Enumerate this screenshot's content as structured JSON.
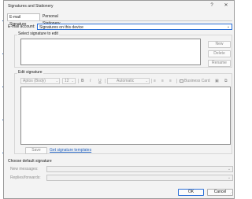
{
  "window": {
    "title": "Signatures and Stationery",
    "help_glyph": "?",
    "close_glyph": "✕"
  },
  "tabs": [
    {
      "label": "E-mail Signature",
      "active": true
    },
    {
      "label": "Personal Stationery",
      "active": false
    }
  ],
  "email_account": {
    "label": "E-mail account:",
    "value": "Signatures on this device"
  },
  "select_signature": {
    "heading": "Select signature to edit",
    "items": [],
    "new_label": "New",
    "delete_label": "Delete",
    "rename_label": "Rename"
  },
  "edit_signature": {
    "heading": "Edit signature",
    "font_value": "Aptos (Body)",
    "size_value": "12",
    "bold_label": "B",
    "italic_label": "I",
    "underline_label": "U",
    "color_value": "Automatic",
    "business_card_label": "Business Card",
    "save_label": "Save",
    "templates_link": "Get signature templates"
  },
  "default_signature": {
    "heading": "Choose default signature",
    "new_messages_label": "New messages:",
    "new_messages_value": "",
    "replies_label": "Replies/forwards:",
    "replies_value": ""
  },
  "footer": {
    "ok_label": "OK",
    "cancel_label": "Cancel"
  },
  "colors": {
    "accent": "#2b6fd6",
    "link": "#1f5fbf",
    "dialog_bg": "#f3f3f3"
  }
}
